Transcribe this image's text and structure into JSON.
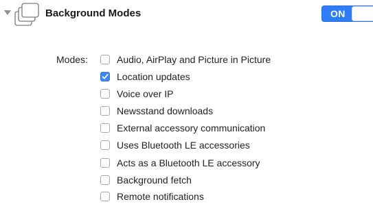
{
  "capability": {
    "title": "Background Modes",
    "toggle_label": "ON",
    "toggle_on": true,
    "accent_color": "#2f7df6"
  },
  "modes": {
    "label": "Modes:",
    "options": [
      {
        "label": "Audio, AirPlay and Picture in Picture",
        "checked": false
      },
      {
        "label": "Location updates",
        "checked": true
      },
      {
        "label": "Voice over IP",
        "checked": false
      },
      {
        "label": "Newsstand downloads",
        "checked": false
      },
      {
        "label": "External accessory communication",
        "checked": false
      },
      {
        "label": "Uses Bluetooth LE accessories",
        "checked": false
      },
      {
        "label": "Acts as a Bluetooth LE accessory",
        "checked": false
      },
      {
        "label": "Background fetch",
        "checked": false
      },
      {
        "label": "Remote notifications",
        "checked": false
      }
    ]
  },
  "icons": {
    "disclosure": "disclosure-triangle-down-icon",
    "capability": "stacked-windows-icon",
    "checkmark": "checkmark-icon"
  }
}
